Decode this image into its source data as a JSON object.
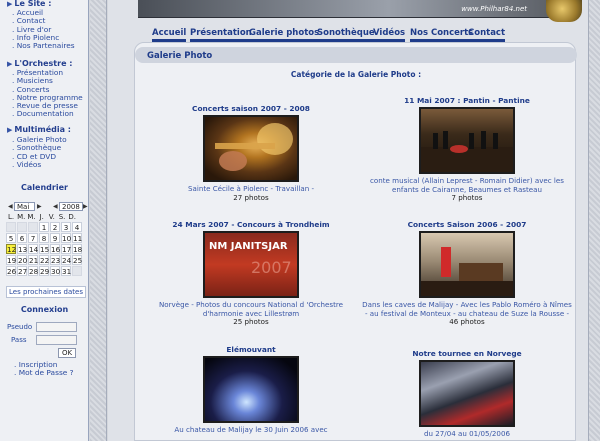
{
  "sidebar": {
    "site_title": "Le Site :",
    "site_links": [
      "Accueil",
      "Contact",
      "Livre d'or",
      "Info Piolenc",
      "Nos Partenaires"
    ],
    "orchestre_title": "L'Orchestre :",
    "orchestre_links": [
      "Présentation",
      "Musiciens",
      "Concerts",
      "Notre programme",
      "Revue de presse",
      "Documentation"
    ],
    "multimedia_title": "Multimédia :",
    "multimedia_links": [
      "Galerie Photo",
      "Sonothèque",
      "CD et DVD",
      "Vidéos"
    ],
    "calendar_title": "Calendrier",
    "calendar": {
      "month": "Mai",
      "year": "2008",
      "day_headers": [
        "L.",
        "M.",
        "M.",
        "J.",
        "V.",
        "S.",
        "D."
      ],
      "weeks": [
        [
          "",
          "",
          "",
          "1",
          "2",
          "3",
          "4"
        ],
        [
          "5",
          "6",
          "7",
          "8",
          "9",
          "10",
          "11"
        ],
        [
          "12",
          "13",
          "14",
          "15",
          "16",
          "17",
          "18"
        ],
        [
          "19",
          "20",
          "21",
          "22",
          "23",
          "24",
          "25"
        ],
        [
          "26",
          "27",
          "28",
          "29",
          "30",
          "31",
          ""
        ]
      ],
      "today": "12"
    },
    "next_dates": "Les prochaines dates",
    "login_title": "Connexion",
    "pseudo_label": "Pseudo",
    "pass_label": "Pass",
    "ok_label": "OK",
    "account_links": [
      "Inscription",
      "Mot de Passe ?"
    ]
  },
  "header": {
    "banner_url": "www.Philhar84.net"
  },
  "menu": [
    "Accueil",
    "Présentation",
    "Galerie photos",
    "Sonothèque",
    "Vidéos",
    "Nos Concerts",
    "Contact"
  ],
  "panel": {
    "title": "Galerie Photo",
    "category_title": "Catégorie de la Galerie Photo :"
  },
  "albums": [
    {
      "title": "Concerts saison 2007 - 2008",
      "caption": "Sainte Cécile à Piolenc - Travaillan -",
      "count": "27 photos"
    },
    {
      "title": "11 Mai 2007 : Pantin - Pantine",
      "caption": "conte musical (Allain Leprest - Romain Didier) avec les enfants de Cairanne, Beaumes et Rasteau",
      "count": "7 photos"
    },
    {
      "title": "24 Mars 2007 - Concours à Trondheim",
      "caption": "Norvège - Photos du concours National d 'Orchestre d'harmonie avec Lillestrøm",
      "count": "25 photos"
    },
    {
      "title": "Concerts Saison 2006 - 2007",
      "caption": "Dans les caves de Malijay - Avec les Pablo Roméro à Nîmes - au festival de Monteux - au chateau de Suze la Rousse -",
      "count": "46 photos"
    },
    {
      "title": "Elémouvant",
      "caption": "Au chateau de Malijay le 30 Juin 2006 avec",
      "count": ""
    },
    {
      "title": "Notre tournee en Norvege",
      "caption": "du 27/04 au 01/05/2006",
      "count": ""
    }
  ],
  "thumbnail_text": {
    "album_3": "NM JANITSJAR",
    "album_3_year": "2007"
  }
}
